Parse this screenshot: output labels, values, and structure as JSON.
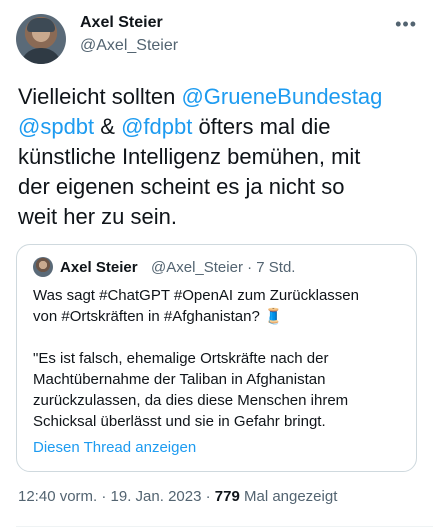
{
  "author": {
    "name": "Axel Steier",
    "handle": "@Axel_Steier",
    "more_glyph": "•••"
  },
  "tweet": {
    "t1": "Vielleicht sollten ",
    "m1": "@GrueneBundestag",
    "nl1": "\n",
    "m2": "@spdbt",
    "t2": " & ",
    "m3": "@fdpbt",
    "t3": " öfters mal die\nkünstliche Intelligenz bemühen, mit\nder eigenen scheint es ja nicht so\nweit her zu sein."
  },
  "quote": {
    "name": "Axel Steier",
    "handle_time": "@Axel_Steier · 7 Std.",
    "text": "Was sagt #ChatGPT #OpenAI zum Zurücklassen\nvon  #Ortskräften in #Afghanistan? 🧵\n\n\"Es ist falsch, ehemalige Ortskräfte nach der\nMachtübernahme der Taliban in Afghanistan\nzurückzulassen, da dies diese Menschen ihrem\nSchicksal überlässt und sie in Gefahr bringt.",
    "thread_link": "Diesen Thread anzeigen"
  },
  "footer": {
    "time": "12:40 vorm. · 19. Jan. 2023 · ",
    "views_count": "779",
    "views_label": " Mal angezeigt"
  },
  "colors": {
    "accent": "#1d9bf0",
    "secondary_text": "#536471",
    "border": "#cfd9de"
  }
}
